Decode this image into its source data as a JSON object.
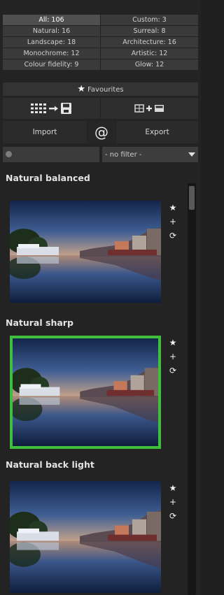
{
  "categories": [
    {
      "label": "All: 106"
    },
    {
      "label": "Custom: 3"
    },
    {
      "label": "Natural: 16"
    },
    {
      "label": "Surreal: 8"
    },
    {
      "label": "Landscape: 18"
    },
    {
      "label": "Architecture: 16"
    },
    {
      "label": "Monochrome: 12"
    },
    {
      "label": "Artistic: 12"
    },
    {
      "label": "Colour fidelity: 9"
    },
    {
      "label": "Glow: 12"
    }
  ],
  "favourites_label": "Favourites",
  "import_label": "Import",
  "at_symbol": "@",
  "export_label": "Export",
  "filter": {
    "selected": "- no filter -"
  },
  "presets": [
    {
      "title": "Natural balanced"
    },
    {
      "title": "Natural sharp",
      "selected": true
    },
    {
      "title": "Natural back light"
    }
  ],
  "icons": [
    "grid-save-icon",
    "compare-icon",
    "search-icon",
    "star-icon",
    "plus-icon",
    "refresh-icon",
    "dropdown-arrow-icon"
  ],
  "colors": {
    "selection": "#3fbf3c",
    "panel_bg": "#232323"
  }
}
